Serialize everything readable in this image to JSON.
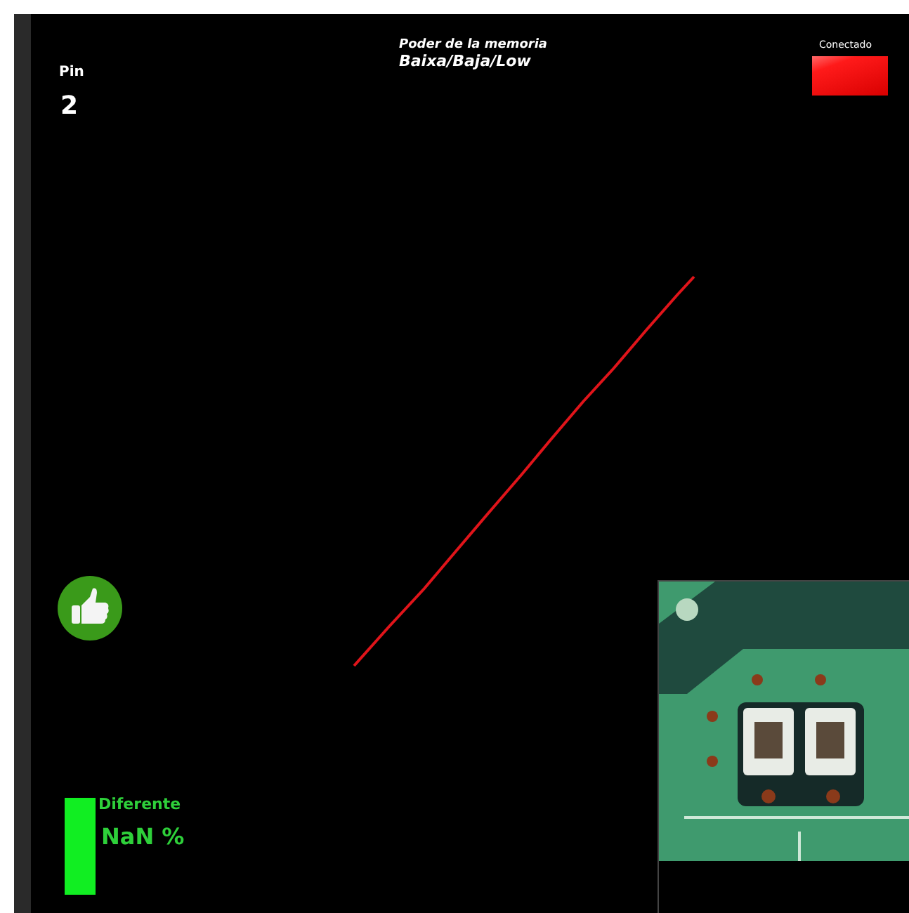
{
  "pin": {
    "label": "Pin",
    "value": "2"
  },
  "header": {
    "title": "Poder de la memoria",
    "subtitle": "Baixa/Baja/Low"
  },
  "connection": {
    "label": "Conectado",
    "lit": true
  },
  "result": {
    "label": "Diferente",
    "value": "NaN %"
  }
}
